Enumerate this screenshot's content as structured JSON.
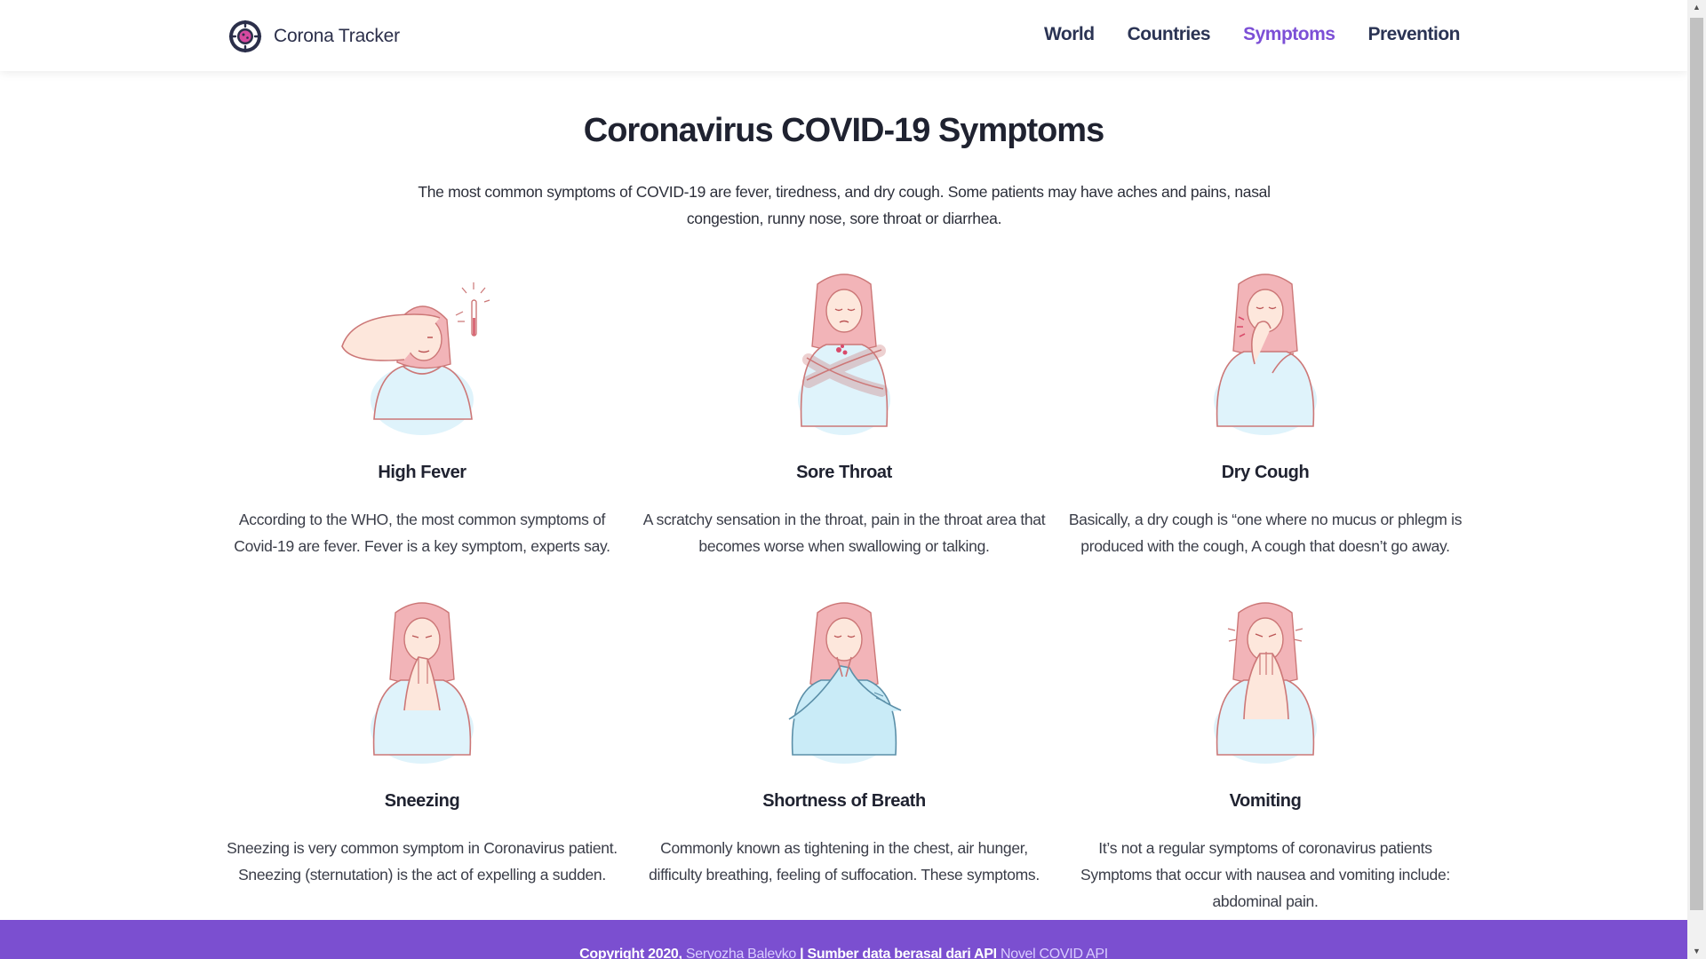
{
  "brand": {
    "name": "Corona Tracker",
    "logo_icon": "virus-logo-icon"
  },
  "nav": {
    "items": [
      {
        "label": "World",
        "active": false
      },
      {
        "label": "Countries",
        "active": false
      },
      {
        "label": "Symptoms",
        "active": true
      },
      {
        "label": "Prevention",
        "active": false
      }
    ]
  },
  "main": {
    "title": "Coronavirus COVID-19 Symptoms",
    "intro": "The most common symptoms of COVID-19 are fever, tiredness, and dry cough. Some patients may have aches and pains, nasal congestion, runny nose, sore throat or diarrhea."
  },
  "symptoms": [
    {
      "title": "High Fever",
      "icon": "high-fever-illustration",
      "description": "According to the WHO, the most common symptoms of Covid-19 are fever. Fever is a key symptom, experts say."
    },
    {
      "title": "Sore Throat",
      "icon": "sore-throat-illustration",
      "description": "A scratchy sensation in the throat, pain in the throat area that becomes worse when swallowing or talking."
    },
    {
      "title": "Dry Cough",
      "icon": "dry-cough-illustration",
      "description": "Basically, a dry cough is “one where no mucus or phlegm is produced with the cough, A cough that doesn’t go away."
    },
    {
      "title": "Sneezing",
      "icon": "sneezing-illustration",
      "description": "Sneezing is very common symptom in Coronavirus patient. Sneezing (sternutation) is the act of expelling a sudden."
    },
    {
      "title": "Shortness of Breath",
      "icon": "shortness-of-breath-illustration",
      "description": "Commonly known as tightening in the chest, air hunger, difficulty breathing, feeling of suffocation. These symptoms."
    },
    {
      "title": "Vomiting",
      "icon": "vomiting-illustration",
      "description": "It’s not a regular symptoms of coronavirus patients Symptoms that occur with nausea and vomiting include: abdominal pain."
    }
  ],
  "footer": {
    "prefix": "Copyright 2020,",
    "author": "Seryozha Balevko",
    "middle": "| Sumber data berasal dari API",
    "api": "Novel COVID API"
  },
  "colors": {
    "accent": "#7c4fd6",
    "footer": "#7b4fd0",
    "nav_text": "#2b3454",
    "shirt": "#dff3fb",
    "hair": "#f2b4b8",
    "skin": "#fde7dc"
  }
}
